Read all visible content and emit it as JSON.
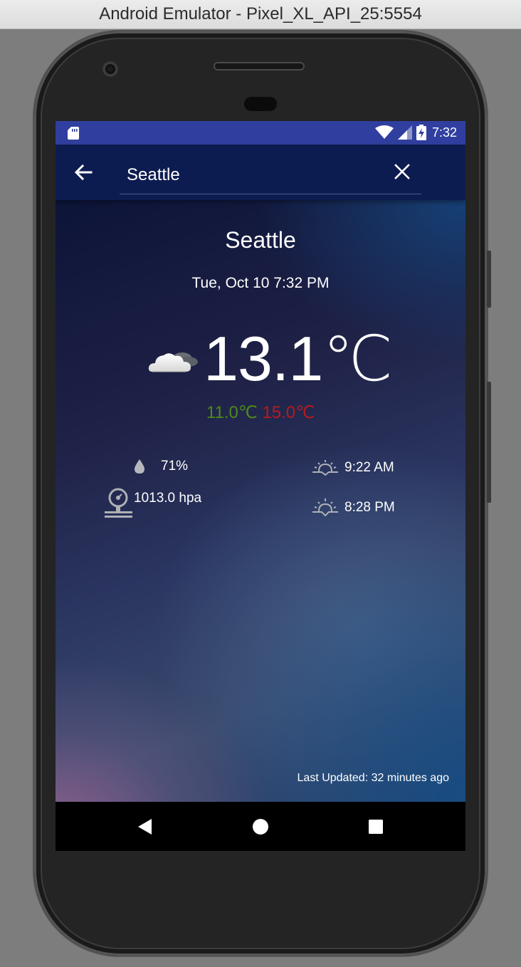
{
  "window": {
    "title": "Android Emulator - Pixel_XL_API_25:5554"
  },
  "status_bar": {
    "time": "7:32",
    "icons": [
      "sd-card-icon",
      "wifi-icon",
      "signal-icon",
      "battery-charging-icon"
    ]
  },
  "toolbar": {
    "search_value": "Seattle",
    "back_icon": "arrow-back-icon",
    "clear_icon": "close-icon"
  },
  "weather": {
    "city": "Seattle",
    "datetime": "Tue, Oct 10 7:32 PM",
    "condition_icon": "partly-cloudy-night-icon",
    "temperature": "13.1℃",
    "min": "11.0℃",
    "max": "15.0℃",
    "humidity": "71%",
    "pressure": "1013.0 hpa",
    "sunrise": "9:22 AM",
    "sunset": "8:28 PM",
    "last_updated": "Last Updated: 32 minutes ago"
  },
  "colors": {
    "status_bar": "#303f9f",
    "toolbar": "#0d1c50",
    "min_temp": "#4e8a18",
    "max_temp": "#b81a1a"
  },
  "navigation": [
    "back-icon",
    "home-icon",
    "recents-icon"
  ]
}
